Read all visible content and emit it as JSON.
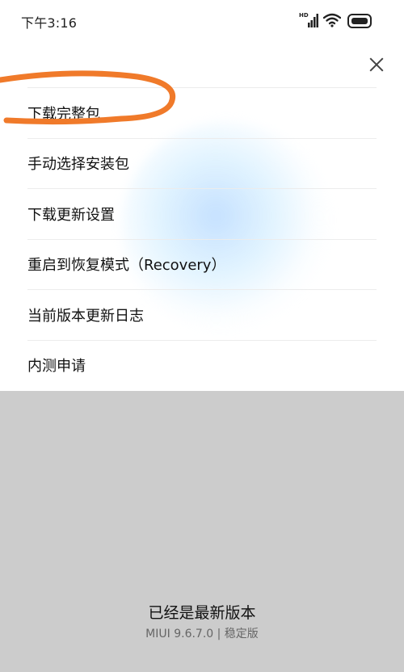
{
  "status_bar": {
    "time": "下午3:16",
    "hd_label": "HD",
    "icons": [
      "signal-icon",
      "wifi-icon",
      "battery-icon"
    ]
  },
  "close_icon": "close-icon",
  "menu": {
    "items": [
      {
        "label": "下载完整包"
      },
      {
        "label": "手动选择安装包"
      },
      {
        "label": "下载更新设置"
      },
      {
        "label": "重启到恢复模式（Recovery）"
      },
      {
        "label": "当前版本更新日志"
      },
      {
        "label": "内测申请"
      }
    ]
  },
  "annotation": {
    "color": "#f07a2a"
  },
  "footer": {
    "status": "已经是最新版本",
    "version": "MIUI 9.6.7.0 | 稳定版"
  },
  "colors": {
    "overlay": "#cccccc",
    "sheet": "#ffffff",
    "divider": "#ececec"
  }
}
